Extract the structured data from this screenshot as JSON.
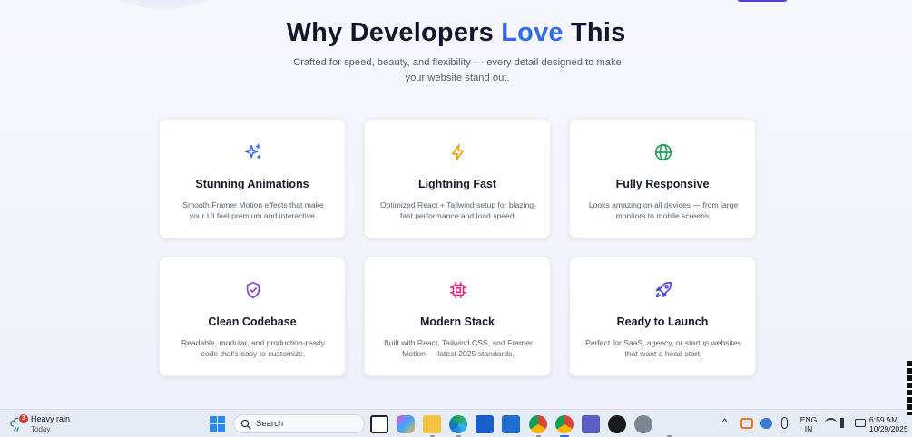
{
  "hero": {
    "title_before": "Why Developers ",
    "title_accent": "Love",
    "title_after": " This",
    "subtitle": "Crafted for speed, beauty, and flexibility — every detail designed to make your website stand out."
  },
  "features": [
    {
      "icon": "sparkles-icon",
      "color": "#3b6fe0",
      "title": "Stunning Animations",
      "description": "Smooth Framer Motion effects that make your UI feel premium and interactive."
    },
    {
      "icon": "lightning-icon",
      "color": "#e5a800",
      "title": "Lightning Fast",
      "description": "Optimized React + Tailwind setup for blazing-fast performance and load speed."
    },
    {
      "icon": "globe-icon",
      "color": "#1f9d55",
      "title": "Fully Responsive",
      "description": "Looks amazing on all devices — from large monitors to mobile screens."
    },
    {
      "icon": "shield-check-icon",
      "color": "#8b3fd9",
      "title": "Clean Codebase",
      "description": "Readable, modular, and production-ready code that's easy to customize."
    },
    {
      "icon": "cpu-icon",
      "color": "#e0307a",
      "title": "Modern Stack",
      "description": "Built with React, Tailwind CSS, and Framer Motion — latest 2025 standards."
    },
    {
      "icon": "rocket-icon",
      "color": "#4f46e5",
      "title": "Ready to Launch",
      "description": "Perfect for SaaS, agency, or startup websites that want a head start."
    }
  ],
  "taskbar": {
    "weather": {
      "badge": "3",
      "condition": "Heavy rain",
      "day": "Today"
    },
    "search_placeholder": "Search",
    "language": {
      "line1": "ENG",
      "line2": "IN"
    },
    "clock": {
      "time": "6:59 AM",
      "date": "10/29/2025"
    }
  },
  "colors": {
    "accent": "#2f6bea",
    "heading": "#12172e"
  }
}
